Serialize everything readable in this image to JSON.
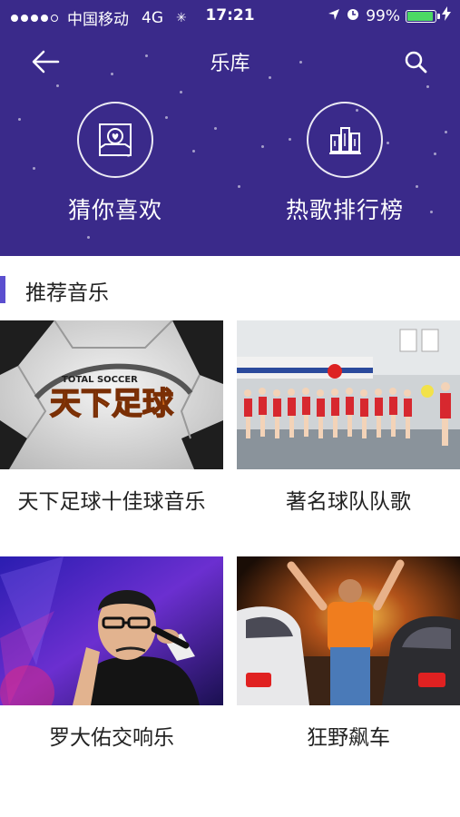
{
  "status": {
    "carrier": "中国移动",
    "network": "4G",
    "time": "17:21",
    "battery": "99%"
  },
  "nav": {
    "title": "乐库"
  },
  "features": [
    {
      "label": "猜你喜欢",
      "icon": "heart-box-icon"
    },
    {
      "label": "热歌排行榜",
      "icon": "ranking-bars-icon"
    }
  ],
  "section": {
    "title": "推荐音乐"
  },
  "cards": [
    {
      "caption": "天下足球十佳球音乐",
      "image_text_small": "TOTAL SOCCER",
      "image_text_big": "天下足球"
    },
    {
      "caption": "著名球队队歌"
    },
    {
      "caption": "罗大佑交响乐"
    },
    {
      "caption": "狂野飙车"
    }
  ],
  "colors": {
    "header": "#3a2a8a",
    "accent": "#5b4fcf",
    "battery": "#4cd964"
  }
}
